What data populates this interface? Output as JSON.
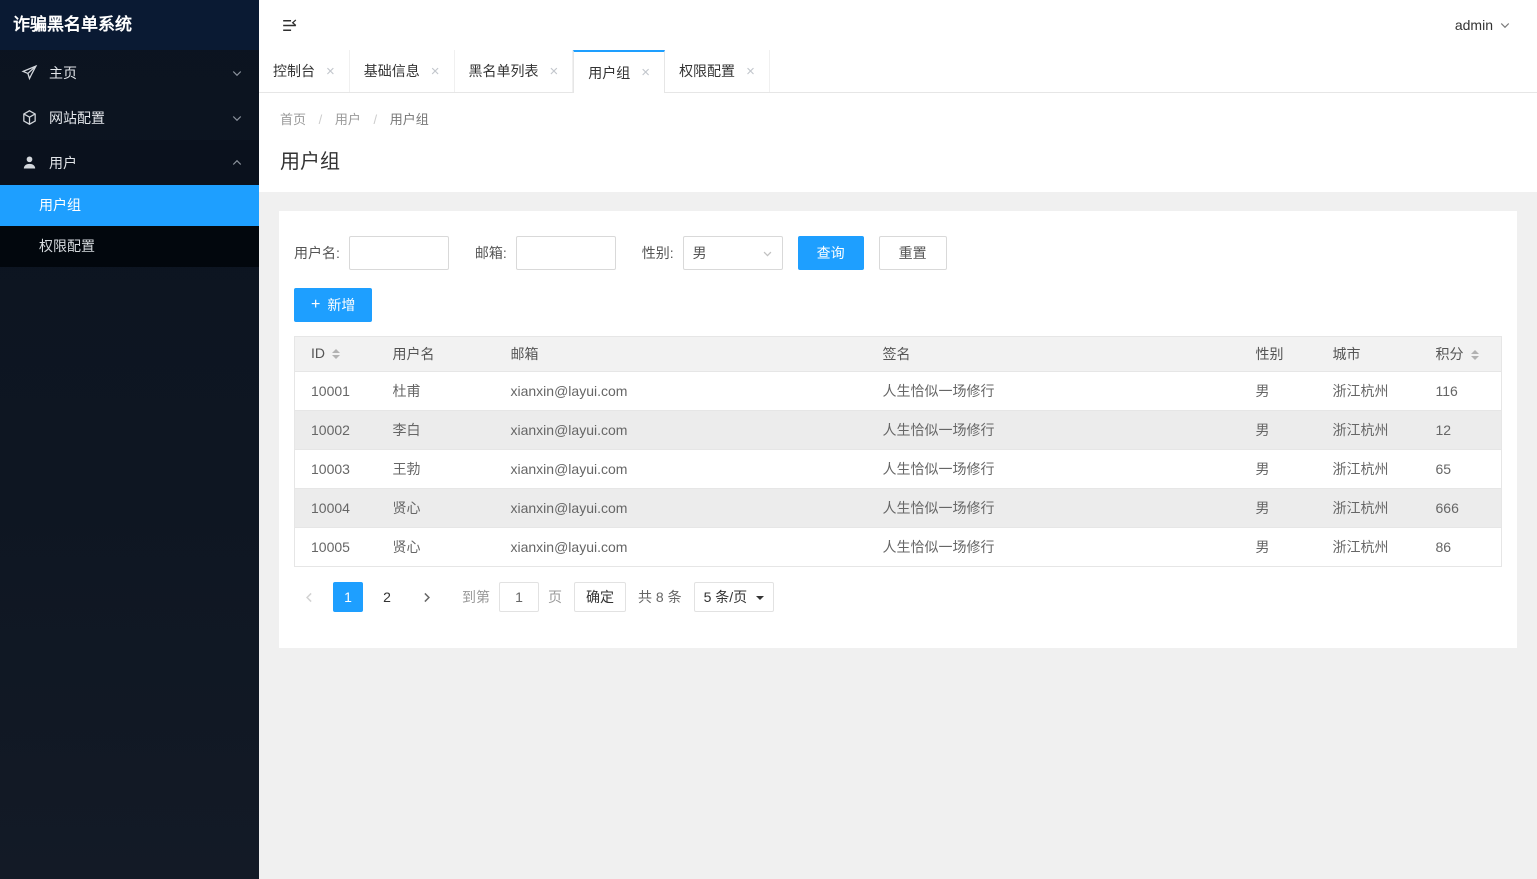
{
  "colors": {
    "accent": "#1e9fff",
    "sidebar_bg": "#0c1422",
    "submenu_bg": "#070d16"
  },
  "icons": {
    "close": "×",
    "plus": "+"
  },
  "sidebar": {
    "title": "诈骗黑名单系统",
    "items": [
      {
        "label": "主页",
        "icon": "send-icon",
        "expanded": false
      },
      {
        "label": "网站配置",
        "icon": "cube-icon",
        "expanded": false
      },
      {
        "label": "用户",
        "icon": "user-icon",
        "expanded": true
      }
    ],
    "sub_items": [
      {
        "label": "用户组",
        "active": true
      },
      {
        "label": "权限配置",
        "active": false
      }
    ]
  },
  "topbar": {
    "user": "admin"
  },
  "tabs": [
    {
      "label": "控制台",
      "active": false
    },
    {
      "label": "基础信息",
      "active": false
    },
    {
      "label": "黑名单列表",
      "active": false
    },
    {
      "label": "用户组",
      "active": true
    },
    {
      "label": "权限配置",
      "active": false
    }
  ],
  "breadcrumb": {
    "items": [
      "首页",
      "用户",
      "用户组"
    ],
    "separator": "/"
  },
  "page": {
    "title": "用户组"
  },
  "filters": {
    "username_label": "用户名:",
    "username_value": "",
    "email_label": "邮箱:",
    "email_value": "",
    "gender_label": "性别:",
    "gender_value": "男",
    "search_button": "查询",
    "reset_button": "重置"
  },
  "toolbar": {
    "add_button": "新增"
  },
  "table": {
    "columns": [
      "ID",
      "用户名",
      "邮箱",
      "签名",
      "性别",
      "城市",
      "积分"
    ],
    "rows": [
      [
        "10001",
        "杜甫",
        "xianxin@layui.com",
        "人生恰似一场修行",
        "男",
        "浙江杭州",
        "116"
      ],
      [
        "10002",
        "李白",
        "xianxin@layui.com",
        "人生恰似一场修行",
        "男",
        "浙江杭州",
        "12"
      ],
      [
        "10003",
        "王勃",
        "xianxin@layui.com",
        "人生恰似一场修行",
        "男",
        "浙江杭州",
        "65"
      ],
      [
        "10004",
        "贤心",
        "xianxin@layui.com",
        "人生恰似一场修行",
        "男",
        "浙江杭州",
        "666"
      ],
      [
        "10005",
        "贤心",
        "xianxin@layui.com",
        "人生恰似一场修行",
        "男",
        "浙江杭州",
        "86"
      ]
    ]
  },
  "pagination": {
    "pages": [
      "1",
      "2"
    ],
    "current": "1",
    "goto_label": "到第",
    "goto_value": "1",
    "page_unit": "页",
    "confirm_button": "确定",
    "total_text": "共 8 条",
    "page_size": "5 条/页"
  }
}
